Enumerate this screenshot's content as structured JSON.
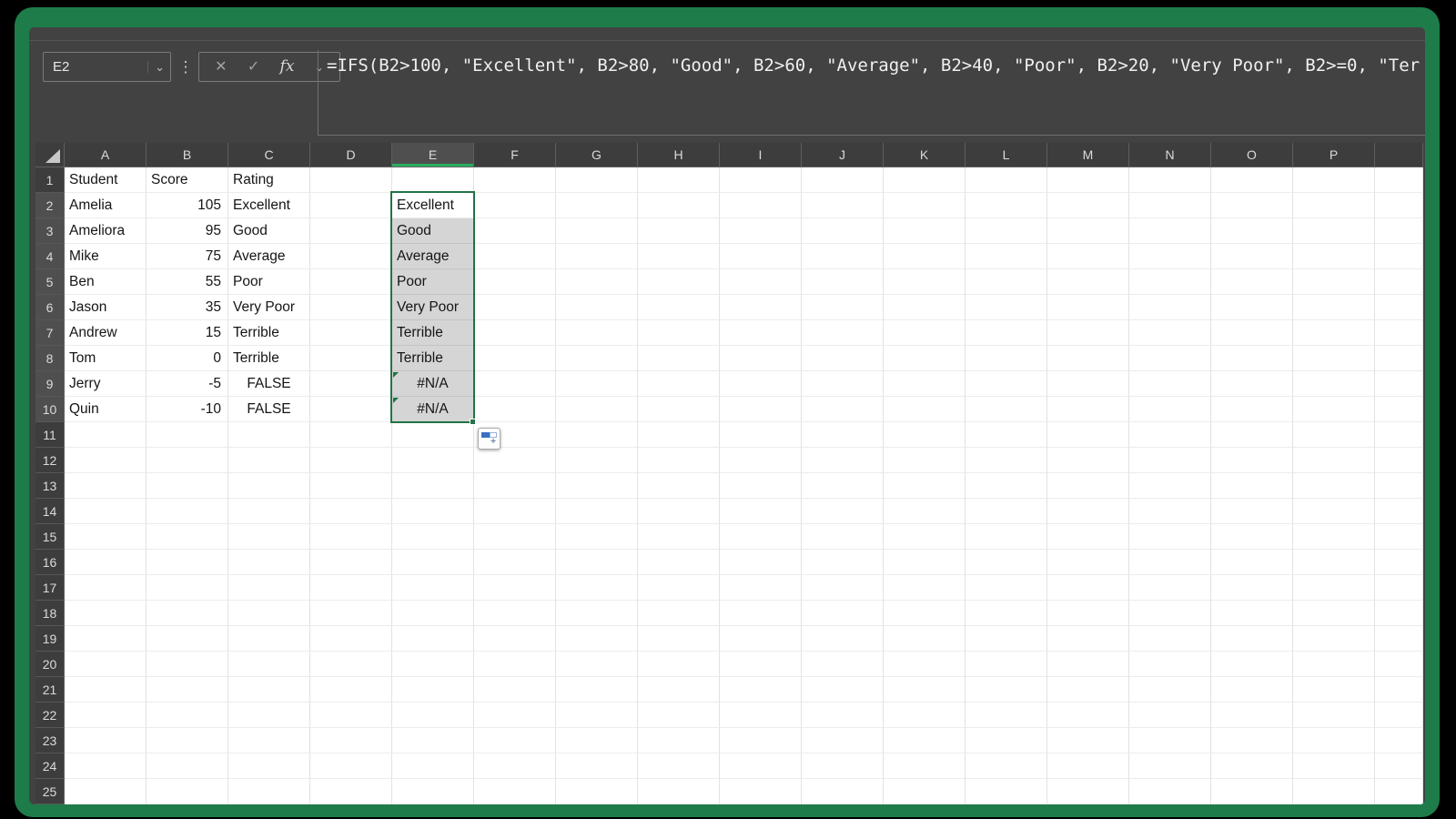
{
  "colors": {
    "frame_green": "#1e7c4a",
    "chrome_bg": "#424242",
    "header_bg": "#3d3d3d",
    "header_sel_bg": "#4f4f4f",
    "header_accent": "#27ae60",
    "excel_green": "#217346",
    "selection_fill": "#d5d5d5",
    "error_indicator": "#1e7145",
    "autofill_blue": "#3b6fc4"
  },
  "name_box": {
    "value": "E2"
  },
  "formula_bar": {
    "grip_icon": "⋮",
    "cancel_icon": "✕",
    "enter_icon": "✓",
    "fx_icon": "fx",
    "name_dropdown_icon": "⌄",
    "fx_dropdown_icon": "⌄",
    "formula": "=IFS(B2>100, \"Excellent\", B2>80, \"Good\", B2>60, \"Average\", B2>40, \"Poor\", B2>20, \"Very Poor\", B2>=0, \"Ter"
  },
  "selection": {
    "range": "E2:E10",
    "active_cell": "E2",
    "column": "E",
    "rows_from": 2,
    "rows_to": 10
  },
  "grid": {
    "columns": [
      "A",
      "B",
      "C",
      "D",
      "E",
      "F",
      "G",
      "H",
      "I",
      "J",
      "K",
      "L",
      "M",
      "N",
      "O",
      "P",
      ""
    ],
    "row_count": 25,
    "error_cells": [
      "E9",
      "E10"
    ],
    "data_rows": [
      {
        "row": 1,
        "cells": {
          "A": "Student",
          "B": "Score",
          "C": "Rating"
        }
      },
      {
        "row": 2,
        "cells": {
          "A": "Amelia",
          "B": "105",
          "C": "Excellent",
          "E": "Excellent"
        }
      },
      {
        "row": 3,
        "cells": {
          "A": "Ameliora",
          "B": "95",
          "C": "Good",
          "E": "Good"
        }
      },
      {
        "row": 4,
        "cells": {
          "A": "Mike",
          "B": "75",
          "C": "Average",
          "E": "Average"
        }
      },
      {
        "row": 5,
        "cells": {
          "A": "Ben",
          "B": "55",
          "C": "Poor",
          "E": "Poor"
        }
      },
      {
        "row": 6,
        "cells": {
          "A": "Jason",
          "B": "35",
          "C": "Very Poor",
          "E": "Very Poor"
        }
      },
      {
        "row": 7,
        "cells": {
          "A": "Andrew",
          "B": "15",
          "C": "Terrible",
          "E": "Terrible"
        }
      },
      {
        "row": 8,
        "cells": {
          "A": "Tom",
          "B": "0",
          "C": "Terrible",
          "E": "Terrible"
        }
      },
      {
        "row": 9,
        "cells": {
          "A": "Jerry",
          "B": "-5",
          "C": "FALSE",
          "E": "#N/A"
        }
      },
      {
        "row": 10,
        "cells": {
          "A": "Quin",
          "B": "-10",
          "C": "FALSE",
          "E": "#N/A"
        }
      }
    ]
  }
}
